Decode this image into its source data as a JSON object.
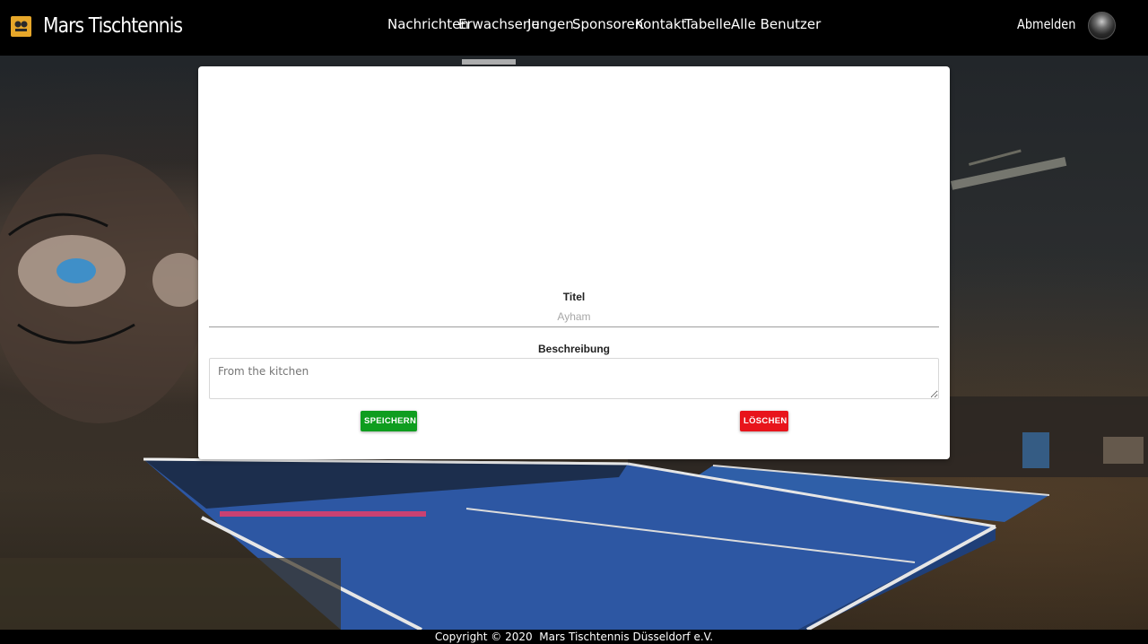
{
  "navbar": {
    "brand": "Mars Tischtennis",
    "links": [
      "Nachrichten",
      "Erwachsene",
      "Jungen",
      "Sponsoren",
      "Kontakt",
      "Tabelle",
      "Alle Benutzer"
    ],
    "logout": "Abmelden"
  },
  "form": {
    "title_label": "Titel",
    "title_placeholder": "Ayham",
    "description_label": "Beschreibung",
    "description_placeholder": "From the kitchen",
    "save_label": "SPEICHERN",
    "delete_label": "LÖSCHEN"
  },
  "footer": {
    "text": "Copyright © 2020  Mars Tischtennis Düsseldorf e.V."
  },
  "colors": {
    "navbar_bg": "#000000",
    "brand_logo": "#e7a72a",
    "save_button": "#0f9d1f",
    "delete_button": "#e8141b",
    "card_bg": "#ffffff"
  }
}
